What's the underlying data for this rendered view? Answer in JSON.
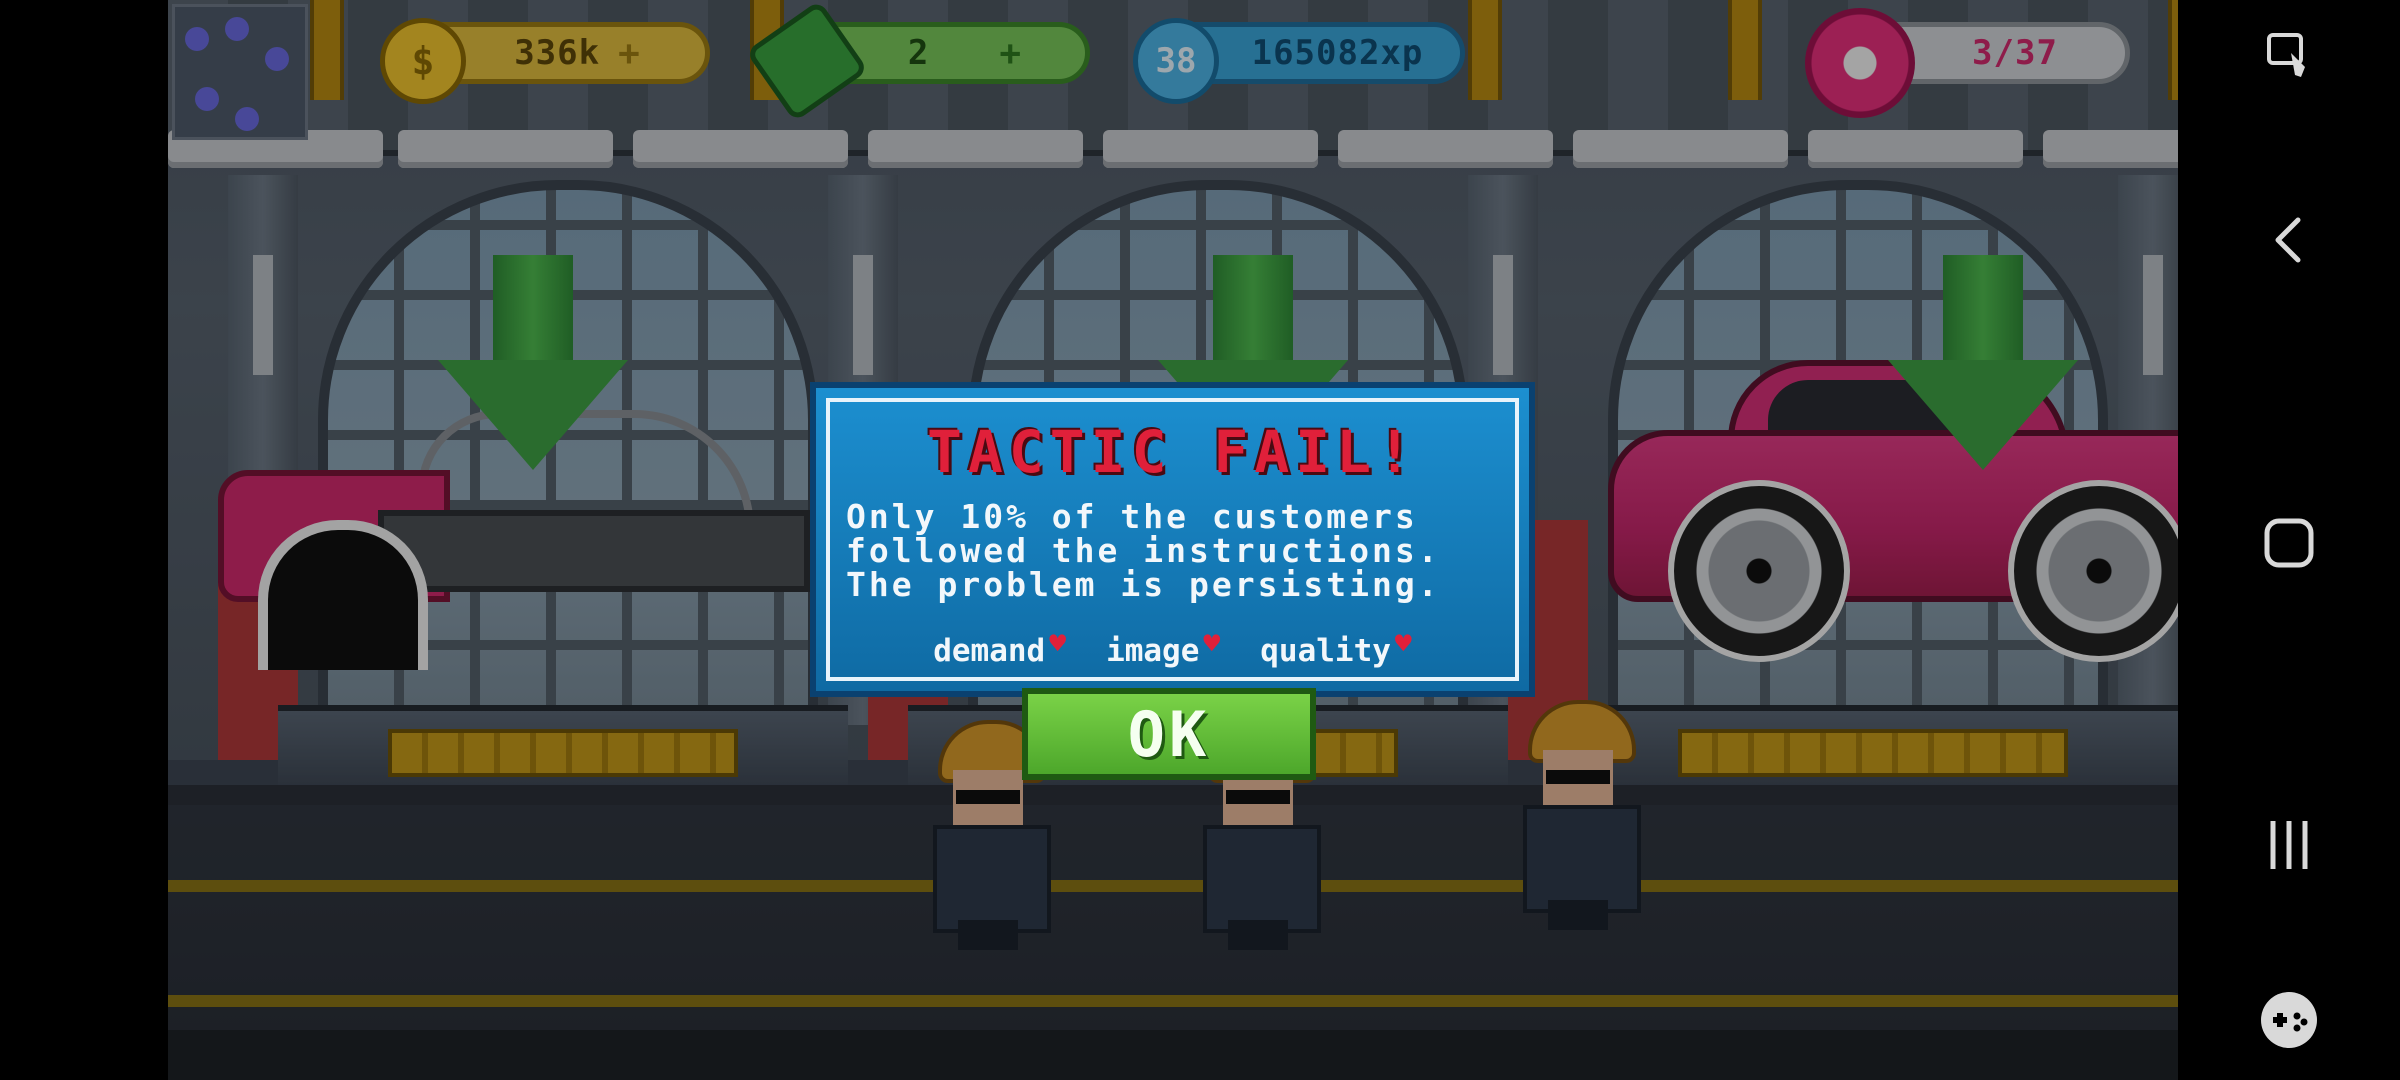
{
  "hud": {
    "coins": "336k",
    "cash": "2",
    "level": "38",
    "xp": "165082xp",
    "donuts": "3/37",
    "plus_symbol": "+",
    "coin_symbol": "$"
  },
  "dialog": {
    "title": "TACTIC FAIL!",
    "message": "Only 10% of the customers\nfollowed the instructions.\nThe problem is persisting.",
    "tags": [
      "demand",
      "image",
      "quality"
    ],
    "ok_label": "OK"
  },
  "colors": {
    "title_red": "#e0203a",
    "dialog_blue": "#1c8fd0",
    "ok_green": "#5cbd35"
  },
  "navbar": {
    "icons": [
      "screenshot-tool-icon",
      "back-icon",
      "home-icon",
      "recents-icon",
      "game-tools-icon"
    ]
  }
}
